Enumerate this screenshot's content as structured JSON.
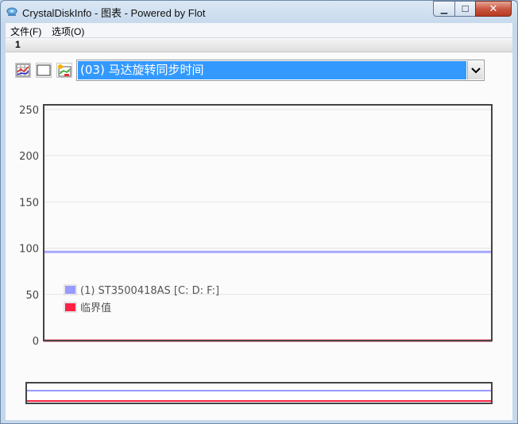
{
  "window": {
    "title": "CrystalDiskInfo - 图表 - Powered by Flot",
    "minimize_glyph": "▁",
    "maximize_glyph": "☐",
    "close_glyph": "✕"
  },
  "menu": [
    {
      "label": "文件(F)"
    },
    {
      "label": "选项(O)"
    }
  ],
  "tab": {
    "label": "1"
  },
  "toolbar": {
    "icons": [
      "chart-multi-icon",
      "blank-frame-icon",
      "chart-refresh-icon"
    ]
  },
  "attribute_select": {
    "selected": "(03) 马达旋转同步时间"
  },
  "colors": {
    "accent": "#3399ff",
    "series_drive": "#9999ff",
    "series_threshold": "#ff2244"
  },
  "chart_data": {
    "type": "line",
    "yticks": [
      0,
      50,
      100,
      150,
      200,
      250
    ],
    "ylim": [
      0,
      255
    ],
    "grid": true,
    "legend_position": "bottom-left",
    "series": [
      {
        "name": "(1) ST3500418AS [C: D: F:]",
        "values": [
          96,
          96
        ],
        "color": "#9999ff"
      },
      {
        "name": "临界值",
        "values": [
          0,
          0
        ],
        "color": "#ff2244"
      }
    ],
    "overview": {
      "ylim": [
        0,
        255
      ]
    }
  }
}
